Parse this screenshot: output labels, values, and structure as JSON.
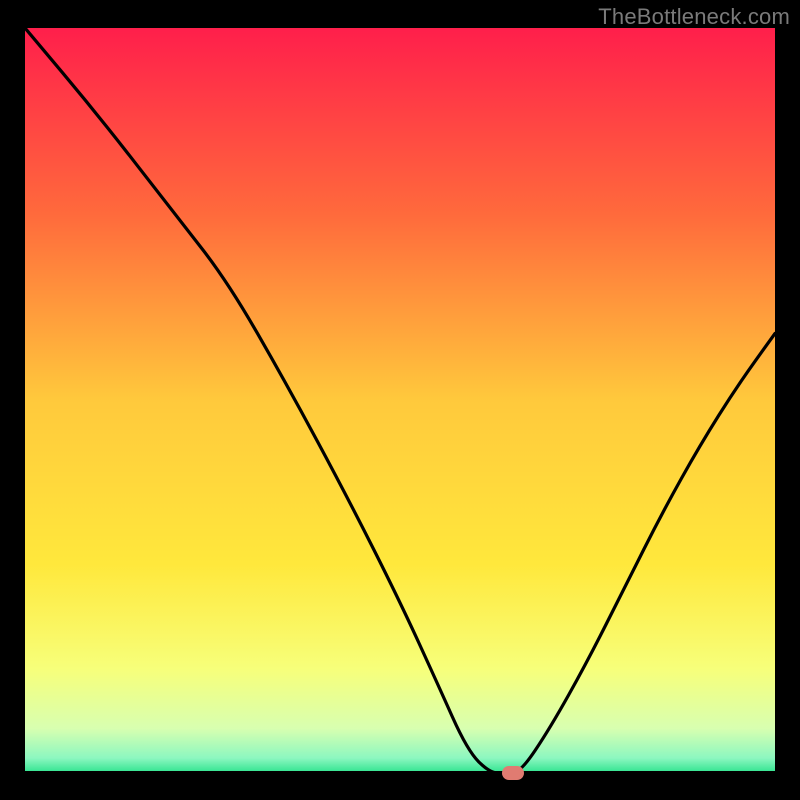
{
  "watermark": "TheBottleneck.com",
  "chart_data": {
    "type": "line",
    "title": "",
    "xlabel": "",
    "ylabel": "",
    "xlim": [
      0,
      100
    ],
    "ylim": [
      0,
      100
    ],
    "series": [
      {
        "name": "bottleneck-curve",
        "x": [
          0,
          10,
          20,
          27,
          35,
          43,
          50,
          55,
          59,
          62,
          64,
          66,
          70,
          75,
          80,
          85,
          90,
          95,
          100
        ],
        "values": [
          100,
          88,
          75,
          66,
          52,
          37,
          23,
          12,
          3,
          0,
          0,
          0,
          6,
          15,
          25,
          35,
          44,
          52,
          59
        ]
      }
    ],
    "marker": {
      "x": 65,
      "y": 0,
      "color": "#e07b71"
    },
    "background_gradient": {
      "stops": [
        {
          "pct": 0,
          "color": "#ff1f4b"
        },
        {
          "pct": 25,
          "color": "#ff6a3c"
        },
        {
          "pct": 50,
          "color": "#ffc93c"
        },
        {
          "pct": 72,
          "color": "#ffe83c"
        },
        {
          "pct": 86,
          "color": "#f7ff7a"
        },
        {
          "pct": 94,
          "color": "#d8ffb0"
        },
        {
          "pct": 98,
          "color": "#8cf7c0"
        },
        {
          "pct": 100,
          "color": "#2de38e"
        }
      ]
    }
  }
}
